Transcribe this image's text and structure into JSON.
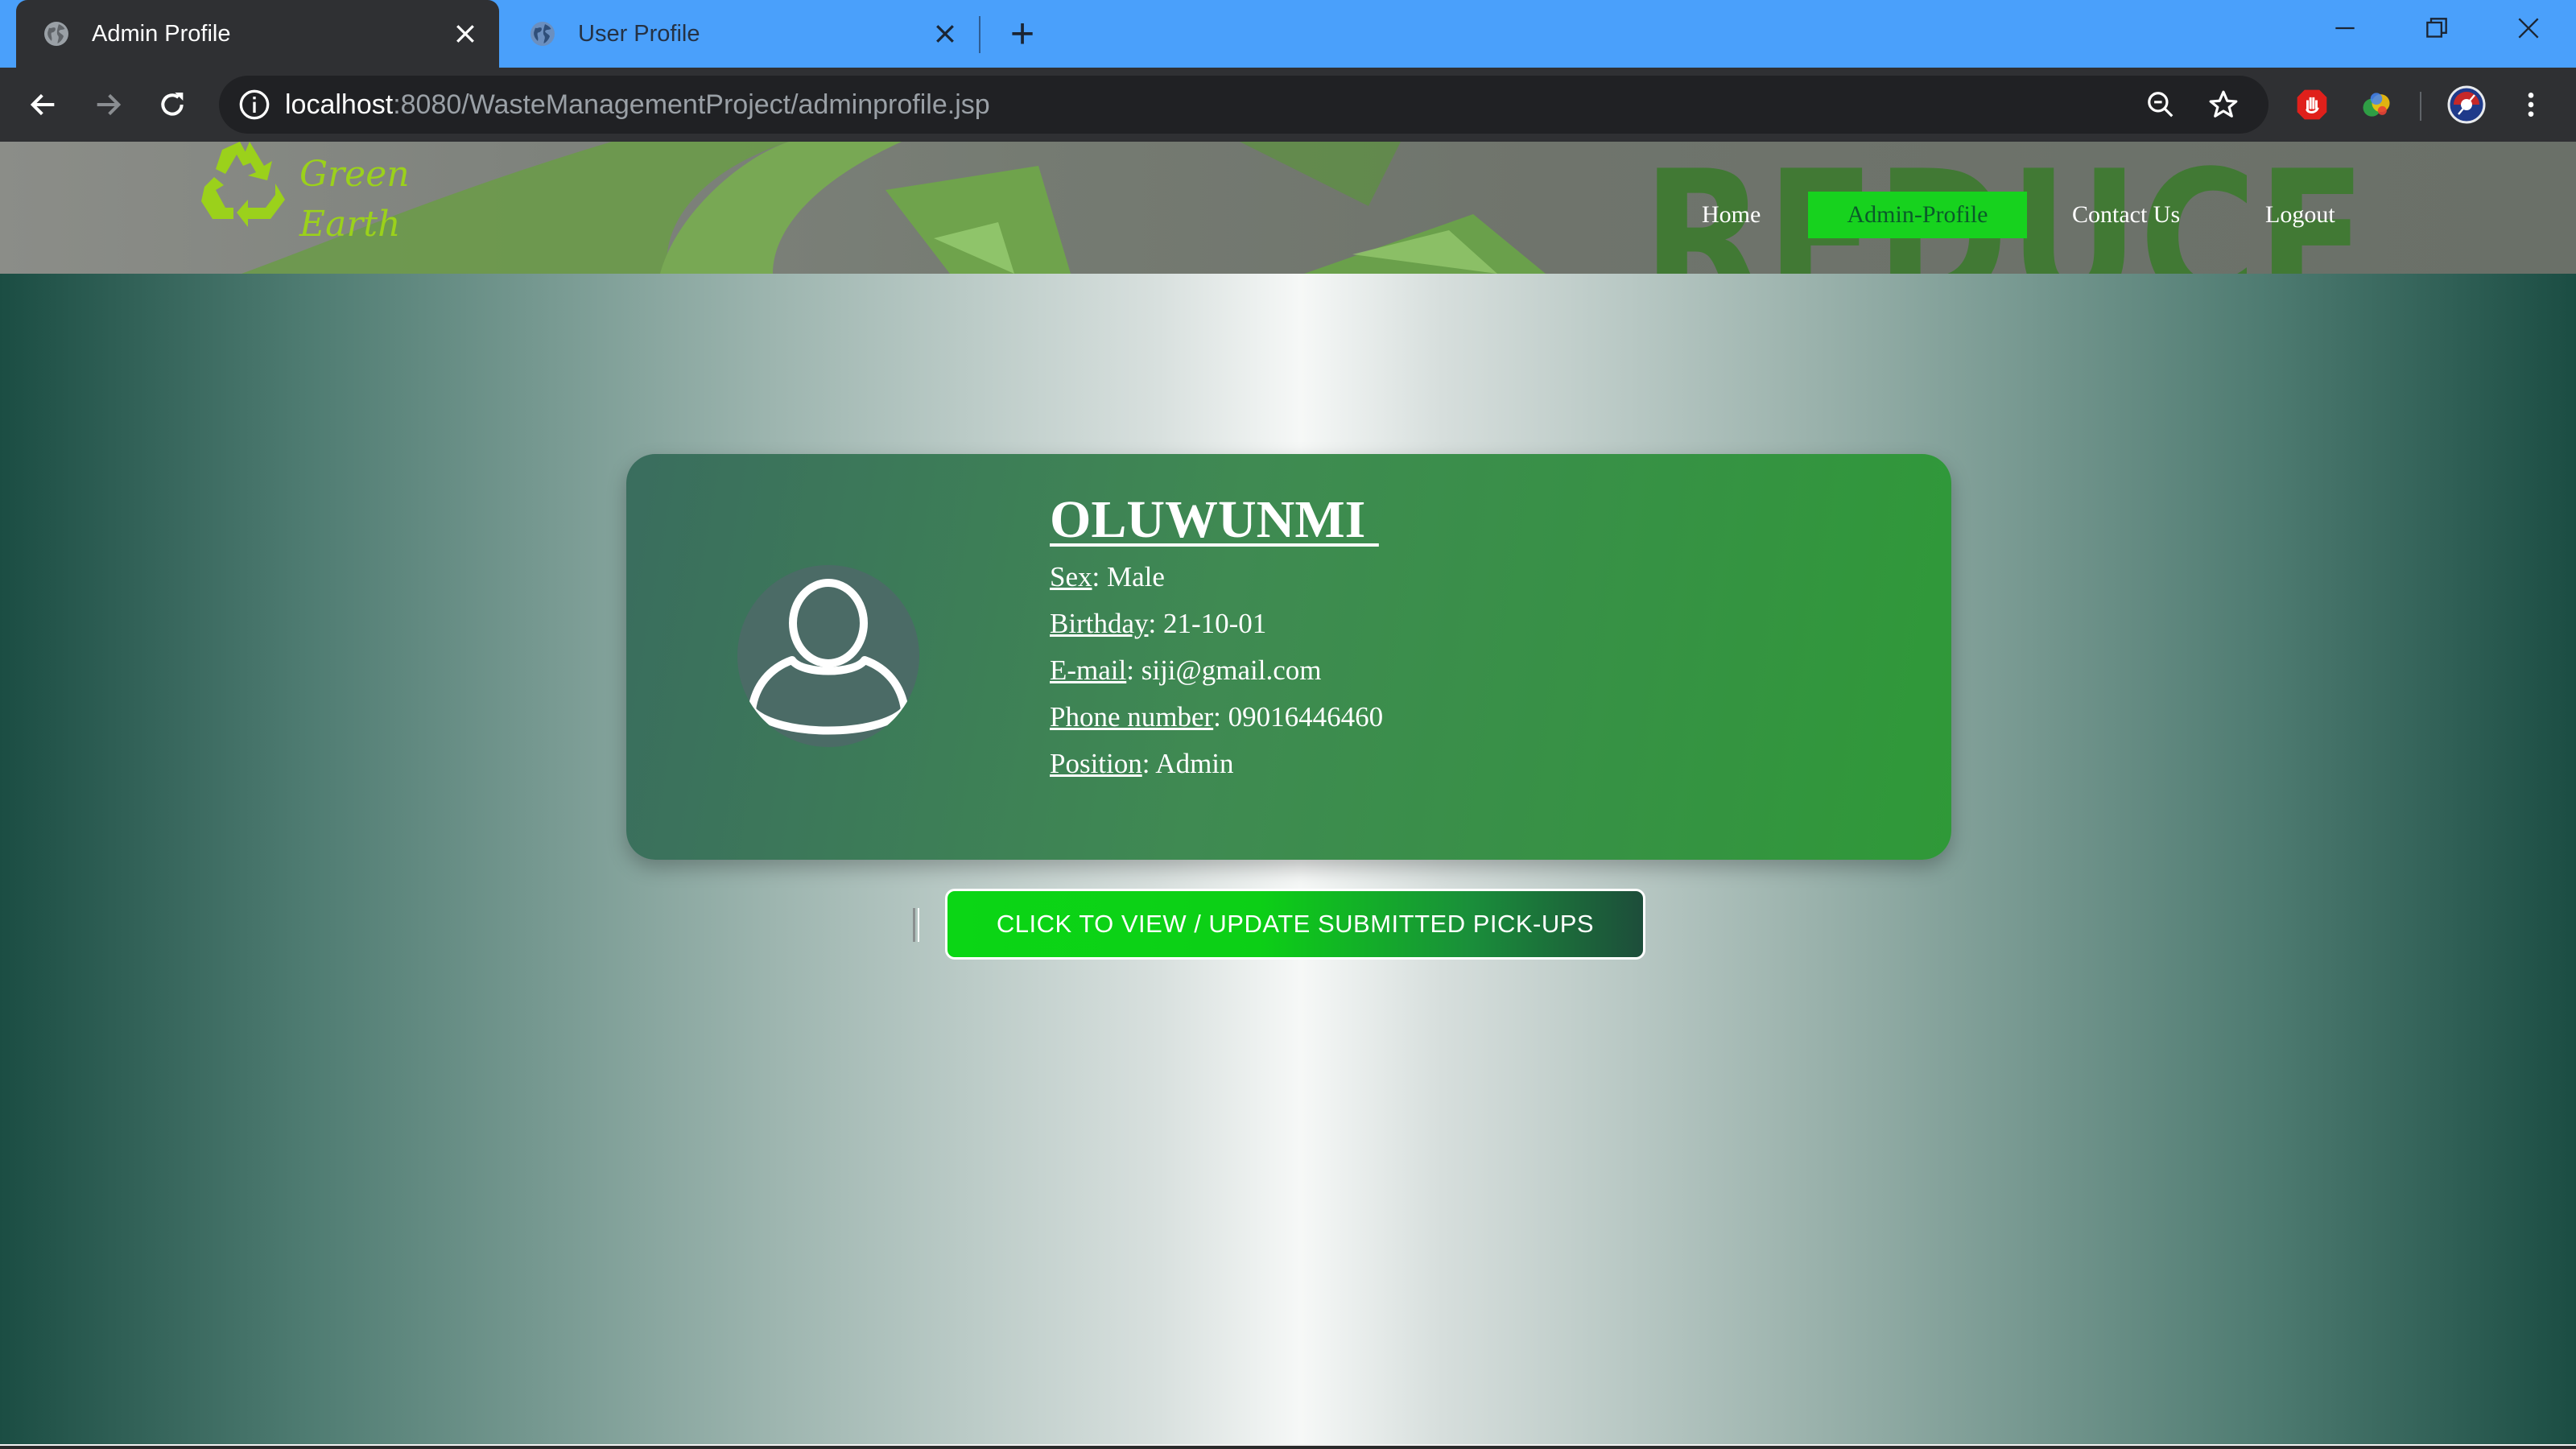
{
  "browser": {
    "tabs": [
      {
        "title": "Admin Profile",
        "active": true
      },
      {
        "title": "User Profile",
        "active": false
      }
    ],
    "new_tab_symbol": "+",
    "address": {
      "host": "localhost",
      "path": ":8080/WasteManagementProject/adminprofile.jsp"
    },
    "icons": [
      "globe-icon",
      "close-icon",
      "back-icon",
      "forward-icon",
      "reload-icon",
      "info-icon",
      "zoom-icon",
      "star-icon",
      "adblock-icon",
      "extension-icon",
      "profile-avatar-icon",
      "menu-icon",
      "minimize-icon",
      "restore-icon",
      "window-close-icon"
    ]
  },
  "site": {
    "logo_line1": "Green",
    "logo_line2": "Earth",
    "nav": [
      {
        "label": "Home",
        "active": false
      },
      {
        "label": "Admin-Profile",
        "active": true
      },
      {
        "label": "Contact Us",
        "active": false
      },
      {
        "label": "Logout",
        "active": false
      }
    ]
  },
  "profile": {
    "name": "OLUWUNMI ",
    "fields": [
      {
        "label": "Sex",
        "value": ": Male"
      },
      {
        "label": "Birthday",
        "value": ": 21-10-01"
      },
      {
        "label": "E-mail",
        "value": ": siji@gmail.com"
      },
      {
        "label": "Phone number",
        "value": ": 09016446460"
      },
      {
        "label": "Position",
        "value": ": Admin"
      }
    ]
  },
  "actions": {
    "view_pickups_label": "CLICK TO VIEW / UPDATE SUBMITTED PICK-UPS"
  },
  "colors": {
    "tab_bar": "#4aa0fb",
    "toolbar": "#2f3033",
    "nav_active": "#17d21e",
    "logo_green": "#9bd11b",
    "card_start": "#3a6d5e",
    "card_end": "#2f9938",
    "button_green": "#0bd615"
  }
}
